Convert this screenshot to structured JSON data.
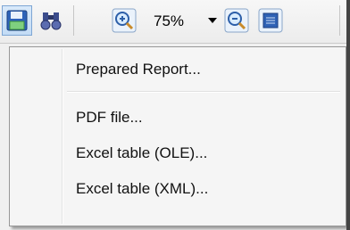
{
  "toolbar": {
    "buttons": [
      {
        "icon": "save-icon"
      },
      {
        "icon": "binoculars-icon"
      },
      {
        "icon": "zoom-in-icon"
      },
      {
        "icon": "zoom-out-icon"
      },
      {
        "icon": "page-view-icon"
      }
    ],
    "zoom_value": "75%",
    "colors": {
      "accent": "#2e63b8",
      "pressed_bg": "#c9dff6"
    }
  },
  "menu": {
    "items": [
      {
        "label": "Prepared Report..."
      },
      {
        "label": "PDF file..."
      },
      {
        "label": "Excel table (OLE)..."
      },
      {
        "label": "Excel table (XML)..."
      }
    ]
  }
}
